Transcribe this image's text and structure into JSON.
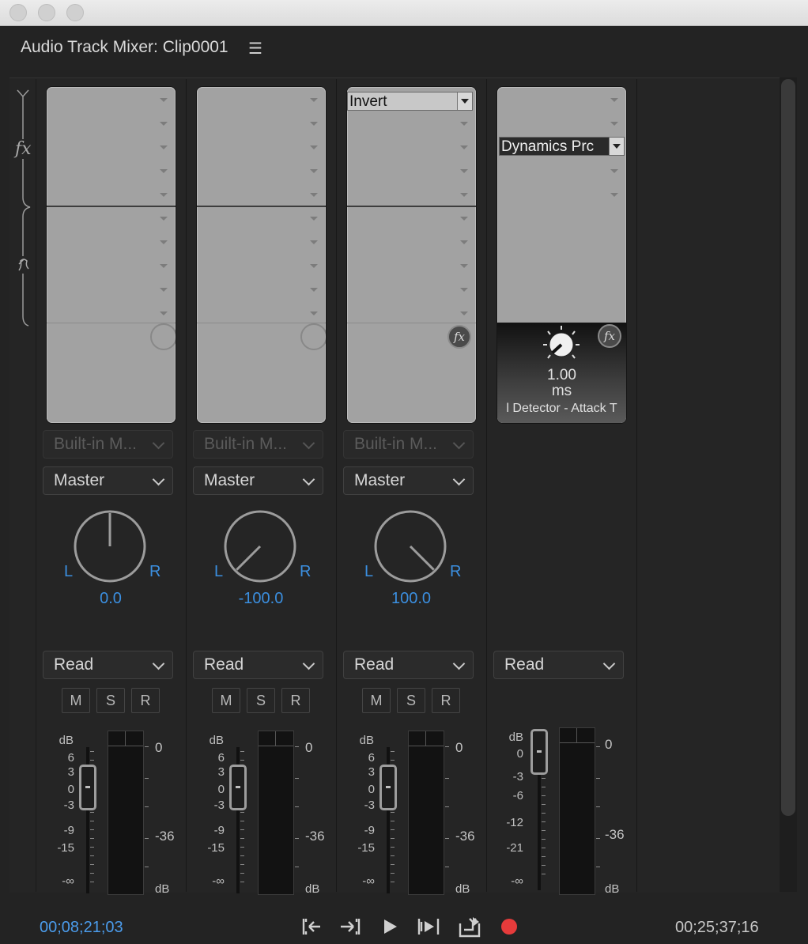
{
  "window": {
    "title": "Audio Track Mixer: Clip0001",
    "menu_icon": "hamburger-icon"
  },
  "rack": {
    "fx_label": "fx",
    "send_icon": "send-icon"
  },
  "tracks": [
    {
      "effect_slot": "",
      "hardware": "Built-in M...",
      "output": "Master",
      "pan_value": "0.0",
      "automation": "Read",
      "buttons": [
        "M",
        "S",
        "R"
      ]
    },
    {
      "effect_slot": "",
      "hardware": "Built-in M...",
      "output": "Master",
      "pan_value": "-100.0",
      "automation": "Read",
      "buttons": [
        "M",
        "S",
        "R"
      ]
    },
    {
      "effect_slot": "Invert",
      "hardware": "Built-in M...",
      "output": "Master",
      "pan_value": "100.0",
      "automation": "Read",
      "buttons": [
        "M",
        "S",
        "R"
      ]
    },
    {
      "effect_slot": "Dynamics Prc",
      "dyn_value": "1.00",
      "dyn_unit": "ms",
      "dyn_param": "l Detector - Attack T",
      "automation": "Read"
    }
  ],
  "fader_scale": {
    "db": "dB",
    "labels": [
      "6",
      "3",
      "0",
      "-3",
      "-9",
      "-15",
      "-∞"
    ]
  },
  "master_fader_scale": {
    "db": "dB",
    "labels": [
      "0",
      "-3",
      "-6",
      "-12",
      "-21",
      "-∞"
    ]
  },
  "meter_scale": {
    "top": "0",
    "mid": "-36",
    "bottom": "dB"
  },
  "transport": {
    "current_time": "00;08;21;03",
    "duration": "00;25;37;16",
    "controls": [
      "go-to-in-icon",
      "go-to-out-icon",
      "play-icon",
      "play-in-to-out-icon",
      "loop-icon",
      "record-icon"
    ],
    "record_color": "#e63b3b"
  },
  "colors": {
    "accent": "#3b8fe0",
    "panel": "#232323",
    "fx_panel": "#a2a2a2"
  }
}
